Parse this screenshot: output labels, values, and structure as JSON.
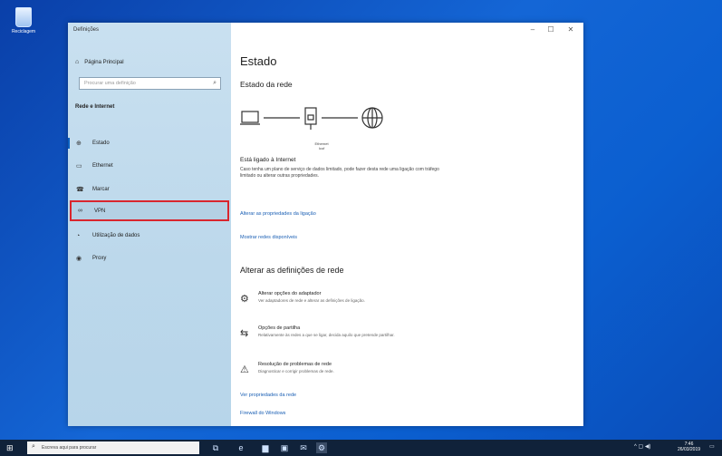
{
  "desktop": {
    "icon_label": "Reciclagem",
    "icon": "recycle-bin-icon"
  },
  "window": {
    "title": "Definições",
    "controls": {
      "minimize": "–",
      "maximize": "☐",
      "close": "✕"
    }
  },
  "sidebar": {
    "home_label": "Página Principal",
    "search_placeholder": "Procurar uma definição",
    "section_title": "Rede e Internet",
    "items": [
      {
        "label": "Estado",
        "icon": "status-icon",
        "glyph": "⊕"
      },
      {
        "label": "Ethernet",
        "icon": "ethernet-icon",
        "glyph": "▭"
      },
      {
        "label": "Marcar",
        "icon": "dial-up-icon",
        "glyph": "☎"
      },
      {
        "label": "VPN",
        "icon": "vpn-icon",
        "glyph": "∞"
      },
      {
        "label": "Utilização de dados",
        "icon": "data-usage-icon",
        "glyph": "◔"
      },
      {
        "label": "Proxy",
        "icon": "proxy-icon",
        "glyph": "◉"
      }
    ],
    "highlight_color": "#d9262e"
  },
  "content": {
    "title": "Estado",
    "network_status_heading": "Estado da rede",
    "diagram_device_label": "Ethernet\nIcof",
    "status_title": "Está ligado à Internet",
    "status_desc": "Caso tenha um plano de serviço de dados limitado, pode fazer desta rede uma ligação com tráfego limitado ou alterar outras propriedades.",
    "link_change_properties": "Alterar as propriedades da ligação",
    "link_show_networks": "Mostrar redes disponíveis",
    "change_settings_heading": "Alterar as definições de rede",
    "options": [
      {
        "title": "Alterar opções do adaptador",
        "desc": "Ver adaptadores de rede e alterar as definições de ligação.",
        "icon": "adapter-icon",
        "glyph": "⚙"
      },
      {
        "title": "Opções de partilha",
        "desc": "Relativamente às redes a que se ligar, decida aquilo que pretende partilhar.",
        "icon": "sharing-icon",
        "glyph": "⇆"
      },
      {
        "title": "Resolução de problemas de rede",
        "desc": "Diagnosticar e corrigir problemas de rede.",
        "icon": "warning-icon",
        "glyph": "⚠"
      }
    ],
    "link_view_properties": "Ver propriedades da rede",
    "link_firewall": "Firewall do Windows"
  },
  "taskbar": {
    "search_placeholder": "Escreva aqui para procurar",
    "apps": [
      {
        "icon": "task-view-icon",
        "glyph": "⧉"
      },
      {
        "icon": "edge-icon",
        "glyph": "e"
      },
      {
        "icon": "file-explorer-icon",
        "glyph": "▆"
      },
      {
        "icon": "store-icon",
        "glyph": "▣"
      },
      {
        "icon": "mail-icon",
        "glyph": "✉"
      },
      {
        "icon": "settings-icon",
        "glyph": "⚙"
      }
    ],
    "tray": "^ ▢ ◀)",
    "time": "7:46",
    "date": "26/03/2019"
  }
}
